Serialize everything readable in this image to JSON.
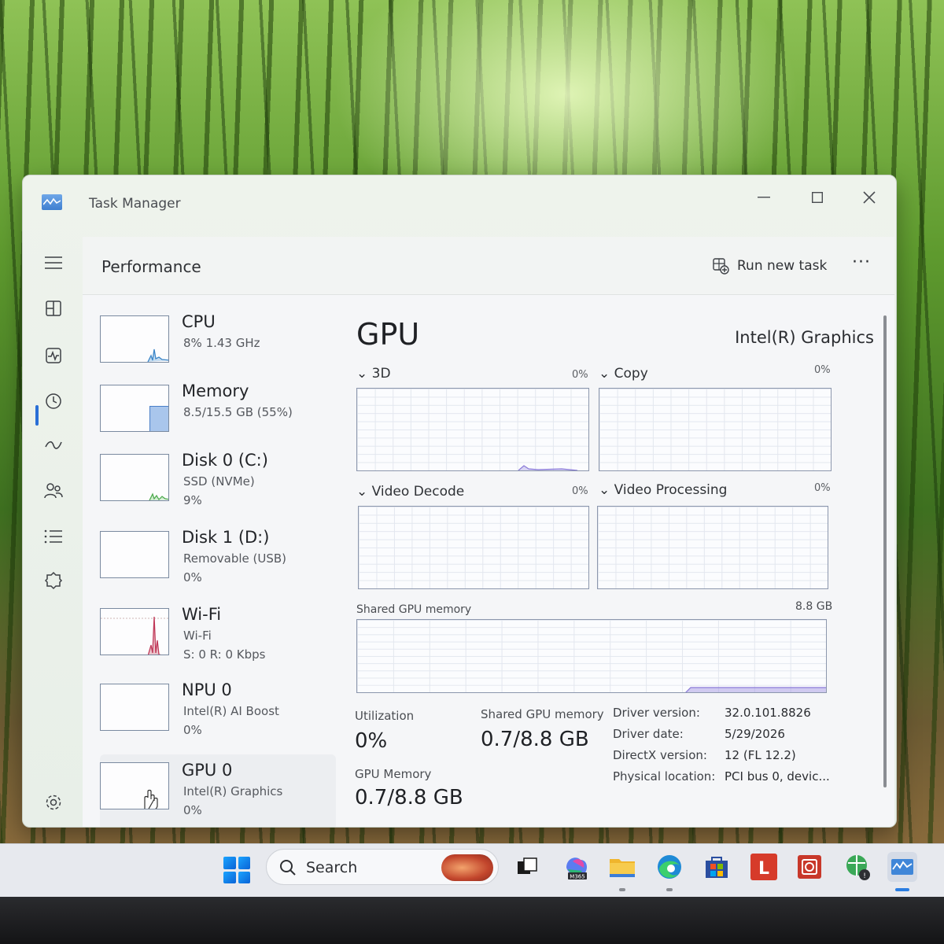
{
  "window": {
    "title": "Task Manager",
    "page_title": "Performance",
    "run_new_task": "Run new task",
    "more": "···"
  },
  "nav": [
    {
      "name": "hamburger-icon"
    },
    {
      "name": "processes-icon"
    },
    {
      "name": "performance-icon",
      "selected": true
    },
    {
      "name": "app-history-icon"
    },
    {
      "name": "startup-apps-icon"
    },
    {
      "name": "users-icon"
    },
    {
      "name": "details-icon"
    },
    {
      "name": "services-icon"
    },
    {
      "name": "settings-icon"
    }
  ],
  "devices": [
    {
      "name": "CPU",
      "sub1": "8%  1.43 GHz",
      "sub2": ""
    },
    {
      "name": "Memory",
      "sub1": "8.5/15.5 GB (55%)",
      "sub2": ""
    },
    {
      "name": "Disk 0 (C:)",
      "sub1": "SSD (NVMe)",
      "sub2": "9%"
    },
    {
      "name": "Disk 1 (D:)",
      "sub1": "Removable (USB)",
      "sub2": "0%"
    },
    {
      "name": "Wi-Fi",
      "sub1": "Wi-Fi",
      "sub2": "S: 0  R: 0 Kbps"
    },
    {
      "name": "NPU 0",
      "sub1": "Intel(R) AI Boost",
      "sub2": "0%"
    },
    {
      "name": "GPU 0",
      "sub1": "Intel(R) Graphics",
      "sub2": "0%",
      "selected": true
    }
  ],
  "gpu": {
    "title": "GPU",
    "model": "Intel(R) Graphics",
    "engines": [
      {
        "label": "3D",
        "pct": "0%"
      },
      {
        "label": "Copy",
        "pct": "0%"
      },
      {
        "label": "Video Decode",
        "pct": "0%"
      },
      {
        "label": "Video Processing",
        "pct": "0%"
      }
    ],
    "shared_memory_label": "Shared GPU memory",
    "shared_memory_max": "8.8 GB",
    "utilization_label": "Utilization",
    "utilization_value": "0%",
    "shared_gpu_memory_label": "Shared GPU memory",
    "shared_gpu_memory_value": "0.7/8.8 GB",
    "gpu_memory_label": "GPU Memory",
    "gpu_memory_value": "0.7/8.8 GB",
    "info": [
      {
        "k": "Driver version:",
        "v": "32.0.101.8826"
      },
      {
        "k": "Driver date:",
        "v": "5/29/2026"
      },
      {
        "k": "DirectX version:",
        "v": "12 (FL 12.2)"
      },
      {
        "k": "Physical location:",
        "v": "PCI bus 0, devic..."
      }
    ]
  },
  "taskbar": {
    "search_label": "Search",
    "m365_label": "M365",
    "l_label": "L"
  },
  "colors": {
    "accent": "#2a6fd6",
    "graph_border": "#8c97ad",
    "gpu_trace": "#9b8de0"
  }
}
